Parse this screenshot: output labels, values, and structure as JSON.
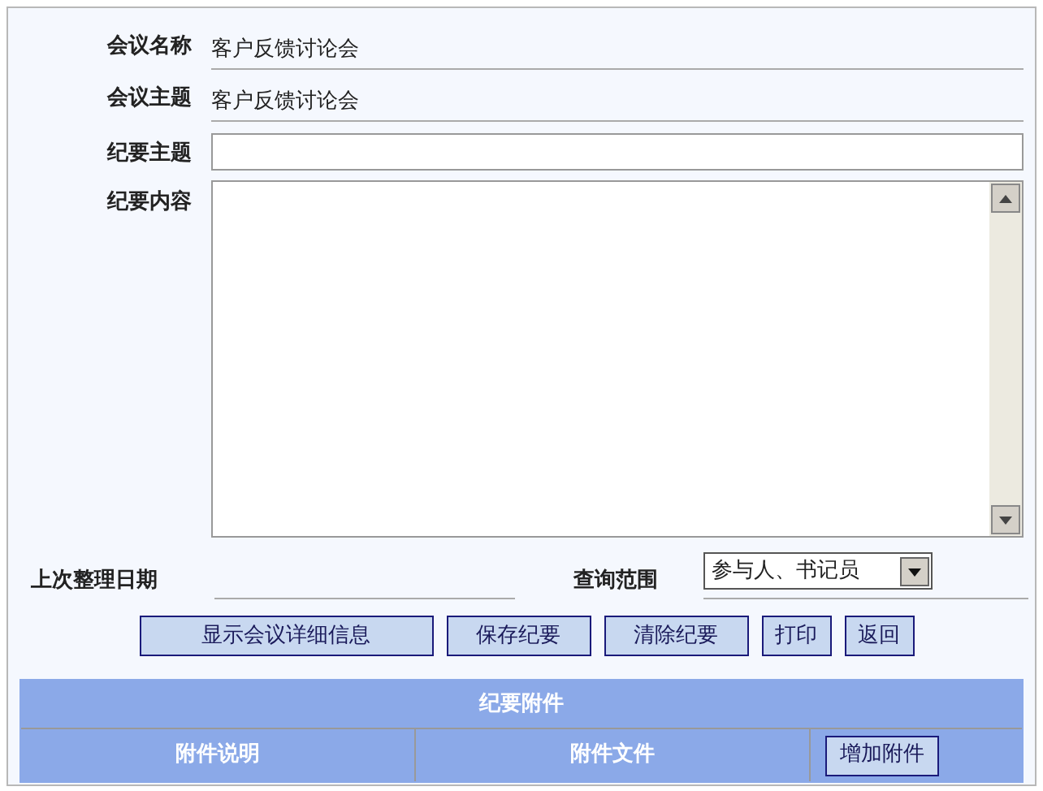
{
  "fields": [
    {
      "kind": "text",
      "label": "会议名称",
      "value": "客户反馈讨论会"
    },
    {
      "kind": "text",
      "label": "会议主题",
      "value": "客户反馈讨论会"
    },
    {
      "kind": "input",
      "label": "纪要主题"
    },
    {
      "kind": "textarea",
      "label": "纪要内容"
    }
  ],
  "last_date": {
    "label": "上次整理日期"
  },
  "scope": {
    "label": "查询范围",
    "value": "参与人、书记员"
  },
  "buttons": [
    "显示会议详细信息",
    "保存纪要",
    "清除纪要",
    "打印",
    "返回"
  ],
  "attachments": {
    "title": "纪要附件",
    "columns": [
      "附件说明",
      "附件文件"
    ],
    "add_button": "增加附件"
  }
}
